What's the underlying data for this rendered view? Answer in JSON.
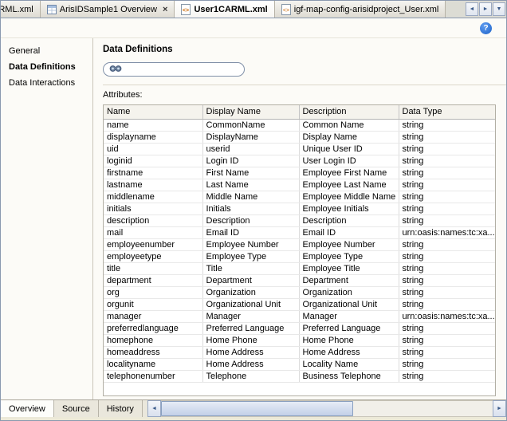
{
  "accent": {
    "frame_border": "#8a99af",
    "help_blue": "#1e63c8"
  },
  "tabs": [
    {
      "label": "ARML.xml",
      "active": false
    },
    {
      "label": "ArisIDSample1 Overview",
      "active": false,
      "close_glyph": "×"
    },
    {
      "label": "User1CARML.xml",
      "active": true
    },
    {
      "label": "igf-map-config-arisidproject_User.xml",
      "active": false
    }
  ],
  "tab_nav": {
    "left_glyph": "◄",
    "right_glyph": "►",
    "list_glyph": "▼"
  },
  "help": {
    "glyph": "?"
  },
  "sidebar": {
    "items": [
      {
        "label": "General",
        "selected": false
      },
      {
        "label": "Data Definitions",
        "selected": true
      },
      {
        "label": "Data Interactions",
        "selected": false
      }
    ]
  },
  "main": {
    "title": "Data Definitions",
    "search": {
      "value": ""
    },
    "attributes_label": "Attributes:",
    "table": {
      "columns": [
        "Name",
        "Display Name",
        "Description",
        "Data Type"
      ],
      "rows": [
        [
          "name",
          "CommonName",
          "Common Name",
          "string"
        ],
        [
          "displayname",
          "DisplayName",
          "Display Name",
          "string"
        ],
        [
          "uid",
          "userid",
          "Unique User ID",
          "string"
        ],
        [
          "loginid",
          "Login ID",
          "User Login ID",
          "string"
        ],
        [
          "firstname",
          "First Name",
          "Employee First Name",
          "string"
        ],
        [
          "lastname",
          "Last Name",
          "Employee Last Name",
          "string"
        ],
        [
          "middlename",
          "Middle Name",
          "Employee Middle Name",
          "string"
        ],
        [
          "initials",
          "Initials",
          "Employee Initials",
          "string"
        ],
        [
          "description",
          "Description",
          "Description",
          "string"
        ],
        [
          "mail",
          "Email ID",
          "Email ID",
          "urn:oasis:names:tc:xa..."
        ],
        [
          "employeenumber",
          "Employee Number",
          "Employee Number",
          "string"
        ],
        [
          "employeetype",
          "Employee Type",
          "Employee Type",
          "string"
        ],
        [
          "title",
          "Title",
          "Employee Title",
          "string"
        ],
        [
          "department",
          "Department",
          "Department",
          "string"
        ],
        [
          "org",
          "Organization",
          "Organization",
          "string"
        ],
        [
          "orgunit",
          "Organizational Unit",
          "Organizational Unit",
          "string"
        ],
        [
          "manager",
          "Manager",
          "Manager",
          "urn:oasis:names:tc:xa..."
        ],
        [
          "preferredlanguage",
          "Preferred Language",
          "Preferred Language",
          "string"
        ],
        [
          "homephone",
          "Home Phone",
          "Home Phone",
          "string"
        ],
        [
          "homeaddress",
          "Home Address",
          "Home Address",
          "string"
        ],
        [
          "localityname",
          "Home Address",
          "Locality Name",
          "string"
        ],
        [
          "telephonenumber",
          "Telephone",
          "Business Telephone",
          "string"
        ]
      ]
    }
  },
  "bottom_tabs": [
    {
      "label": "Overview",
      "active": true
    },
    {
      "label": "Source",
      "active": false
    },
    {
      "label": "History",
      "active": false
    }
  ],
  "scrollbar": {
    "left_glyph": "◄",
    "right_glyph": "►"
  }
}
